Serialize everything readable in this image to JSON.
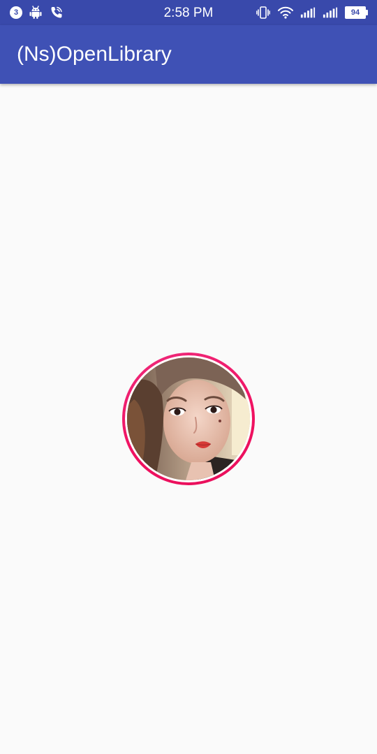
{
  "status_bar": {
    "notification_count": "3",
    "time": "2:58 PM",
    "battery_level": "94",
    "icons": [
      "notification-count-badge",
      "android-icon",
      "phone-call-icon",
      "vibrate-icon",
      "wifi-icon",
      "signal-icon",
      "signal-icon",
      "battery-icon"
    ]
  },
  "app_bar": {
    "title": "(Ns)OpenLibrary"
  },
  "avatar": {
    "icon": "circular-profile-image",
    "border_color": "#f01160"
  },
  "colors": {
    "status_bar": "#3949ab",
    "app_bar": "#3f51b5",
    "background": "#fafafa",
    "avatar_border": "#f01160"
  }
}
